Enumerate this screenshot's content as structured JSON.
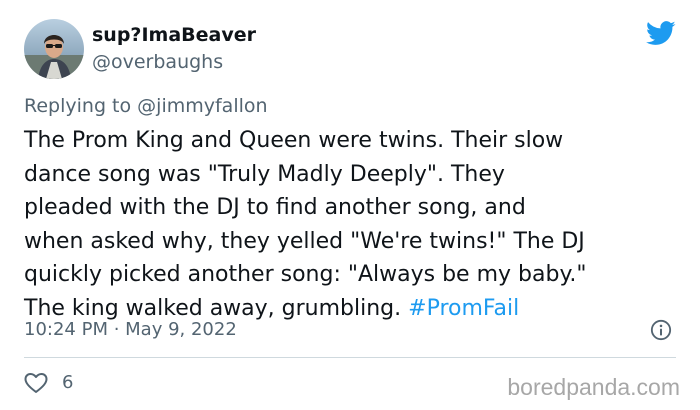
{
  "tweet": {
    "author": {
      "display_name": "sup?ImaBeaver",
      "handle": "@overbaughs"
    },
    "reply": {
      "prefix": "Replying to",
      "mention": "@jimmyfallon"
    },
    "text_lines": [
      "The Prom King and Queen were twins. Their slow",
      "dance song was \"Truly Madly Deeply\". They",
      "pleaded with the DJ to find another song, and",
      "when asked why, they yelled \"We're twins!\" The DJ",
      "quickly picked another song: \"Always be my baby.\"",
      "The king walked away, grumbling."
    ],
    "hashtag": "#PromFail",
    "timestamp": "10:24 PM · May 9, 2022",
    "likes": "6"
  },
  "icons": {
    "brand": "twitter-bird-icon",
    "info": "info-icon",
    "like": "heart-icon"
  },
  "watermark": "boredpanda.com",
  "colors": {
    "accent": "#1d9bf0",
    "text": "#0f1419",
    "secondary": "#536471",
    "divider": "#cfd9de",
    "watermark": "#a7a7a7"
  }
}
